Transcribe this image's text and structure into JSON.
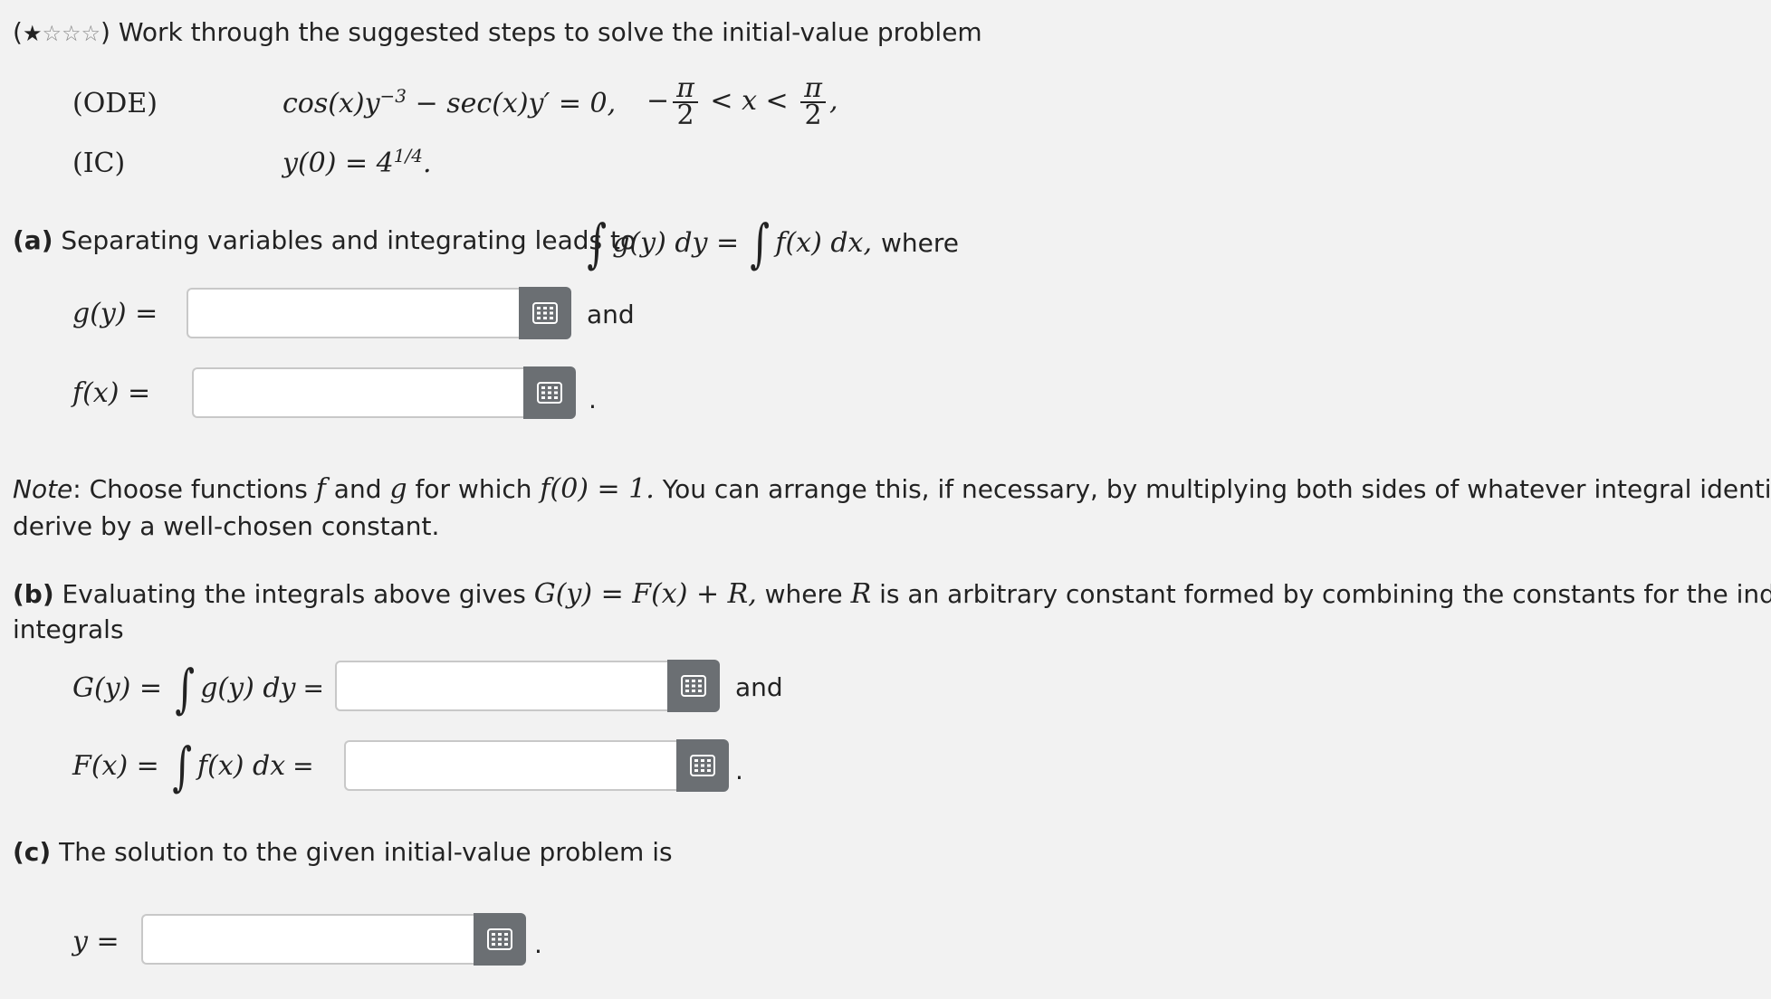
{
  "intro": {
    "stars_filled": "★",
    "stars_empty": "☆☆☆",
    "open_paren": "(",
    "close_paren": ")",
    "text": "Work through the suggested steps to solve the initial-value problem"
  },
  "problem": {
    "ode_label": "(ODE)",
    "ic_label": "(IC)",
    "ode_eq": "cos(x)y",
    "ode_exp": "−3",
    "ode_rest": " − sec(x)y′ = 0,",
    "domain_left": "−",
    "pi": "π",
    "two": "2",
    "domain_mid": "< x <",
    "domain_end": ",",
    "ic_eq": "y(0) = 4",
    "ic_exp": "1/4",
    "ic_end": "."
  },
  "part_a": {
    "label": "(a)",
    "text": "Separating variables and integrating leads to",
    "integral_expr_1": "g(y) dy =",
    "integral_expr_2": "f(x) dx,",
    "where": "where",
    "g_label": "g(y) =",
    "f_label": "f(x) =",
    "and": "and",
    "period": "."
  },
  "note": {
    "label": "Note",
    "colon": ":",
    "line1_a": "Choose functions",
    "f": "f",
    "and": "and",
    "g": "g",
    "line1_b": "for which",
    "cond": "f(0) = 1.",
    "line1_c": "You can arrange this, if necessary, by multiplying both sides of whatever integral identity you",
    "line2": "derive by a well-chosen constant."
  },
  "part_b": {
    "label": "(b)",
    "text_a": "Evaluating the integrals above gives",
    "eq": "G(y) = F(x) + R,",
    "text_b": "where",
    "R": "R",
    "text_c": "is an arbitrary constant formed by combining the constants for the indefinite",
    "line2": "integrals",
    "G_lhs": "G(y) =",
    "G_int": "g(y) dy",
    "F_lhs": "F(x) =",
    "F_int": "f(x) dx",
    "equals": "=",
    "and": "and",
    "period": "."
  },
  "part_c": {
    "label": "(c)",
    "text": "The solution to the given initial-value problem is",
    "y_label": "y =",
    "period": "."
  },
  "inputs": {
    "g_value": "",
    "f_value": "",
    "G_value": "",
    "F_value": "",
    "y_value": ""
  },
  "icons": {
    "keypad": "keypad-icon"
  },
  "colors": {
    "background": "#f2f2f2",
    "button": "#6b6f73",
    "field_border": "#c8c8c8"
  }
}
